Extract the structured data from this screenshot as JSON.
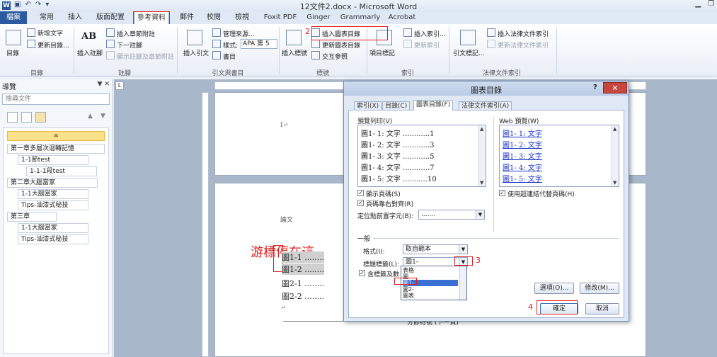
{
  "window": {
    "title": "12文件2.docx - Microsoft Word",
    "app_icon": "W",
    "qat_icons": [
      "save-icon",
      "undo-icon",
      "redo-icon",
      "customize-icon"
    ]
  },
  "ribbon_tabs": [
    "檔案",
    "常用",
    "插入",
    "版面配置",
    "參考資料",
    "郵件",
    "校閱",
    "檢視",
    "Foxit PDF",
    "Ginger",
    "Grammarly",
    "Acrobat"
  ],
  "ribbon": {
    "toc": {
      "big": "目錄",
      "add_text": "新增文字",
      "update": "更新目錄...",
      "group": "目錄"
    },
    "footnotes": {
      "insert": "插入註腳",
      "insert_endnote": "插入章節附註",
      "next": "下一註腳",
      "show": "顯示註腳及章節附註",
      "group": "註腳",
      "ab_label": "AB"
    },
    "citations": {
      "insert": "插入引文",
      "manage": "管理來源...",
      "style_label": "樣式:",
      "style_value": "APA 第 5",
      "bibliography": "書目",
      "group": "引文與書目"
    },
    "captions": {
      "insert": "插入標號",
      "insert_table": "插入圖表目錄",
      "update_table": "更新圖表目錄",
      "cross_ref": "交互參照",
      "group": "標號"
    },
    "index": {
      "mark": "項目標記",
      "insert": "插入索引...",
      "update": "更新索引",
      "group": "索引"
    },
    "authorities": {
      "mark": "引文標記...",
      "insert": "插入法律文件索引",
      "update": "更新法律文件索引",
      "group": "法律文件索引"
    }
  },
  "nav": {
    "title": "導覽",
    "search_placeholder": "搜尋文件",
    "items": [
      {
        "label": "≍",
        "level": 0,
        "selected": true
      },
      {
        "label": "第一章多層次迴轉記憶",
        "level": 0
      },
      {
        "label": "1-1節test",
        "level": 1
      },
      {
        "label": "1-1-1段test",
        "level": 2
      },
      {
        "label": "第二章大腦當家",
        "level": 0
      },
      {
        "label": "1-1大腦當家",
        "level": 1
      },
      {
        "label": "Tips-油漆式秘技",
        "level": 1
      },
      {
        "label": "第三章",
        "level": 0
      },
      {
        "label": "1-1大腦當家",
        "level": 1
      },
      {
        "label": "Tips-油漆式秘技",
        "level": 1
      }
    ]
  },
  "document": {
    "heading": "論文",
    "annotation": "游標停在這",
    "lines": [
      "圖1-1 ........",
      "圖1-2 ........",
      "圖2-1 ........",
      "圖2-2 ........"
    ],
    "section_break": "分節符號 (下一頁)"
  },
  "dialog": {
    "title": "圖表目錄",
    "help": "?",
    "tabs": [
      "索引(X)",
      "目錄(C)",
      "圖表目錄(F)",
      "法律文件索引(A)"
    ],
    "active_tab": 2,
    "print_preview_label": "預覽列印(V)",
    "print_preview": [
      {
        "text": "圖1- 1: 文字",
        "page": "1"
      },
      {
        "text": "圖1- 2: 文字",
        "page": "3"
      },
      {
        "text": "圖1- 3: 文字",
        "page": "5"
      },
      {
        "text": "圖1- 4: 文字",
        "page": "7"
      },
      {
        "text": "圖1- 5: 文字",
        "page": "10"
      }
    ],
    "web_preview_label": "Web 預覽(W)",
    "web_preview": [
      "圖1- 1: 文字",
      "圖1- 2: 文字",
      "圖1- 3: 文字",
      "圖1- 4: 文字",
      "圖1- 5: 文字"
    ],
    "show_page_numbers": "顯示頁碼(S)",
    "right_align": "頁碼靠右對齊(R)",
    "tab_leader_label": "定位點前置字元(B):",
    "tab_leader_value": ".......",
    "use_hyperlinks": "使用超連結代替頁碼(H)",
    "general_label": "一般",
    "formats_label": "格式(I):",
    "formats_value": "取自範本",
    "caption_label": "標題標籤(L):",
    "caption_value": "圖1-",
    "include_label": "含標籤及數",
    "dropdown_options": [
      "表格",
      "圖",
      "圖1-",
      "圖2-",
      "圖表"
    ],
    "dropdown_selected": 2,
    "options_btn": "選項(O)...",
    "modify_btn": "修改(M)...",
    "ok_btn": "確定",
    "cancel_btn": "取消"
  },
  "annotations": [
    "1",
    "2",
    "3",
    "4"
  ],
  "colors": {
    "highlight_red": "#e02020",
    "file_tab": "#2c5aa0",
    "link_blue": "#1a33c8"
  }
}
